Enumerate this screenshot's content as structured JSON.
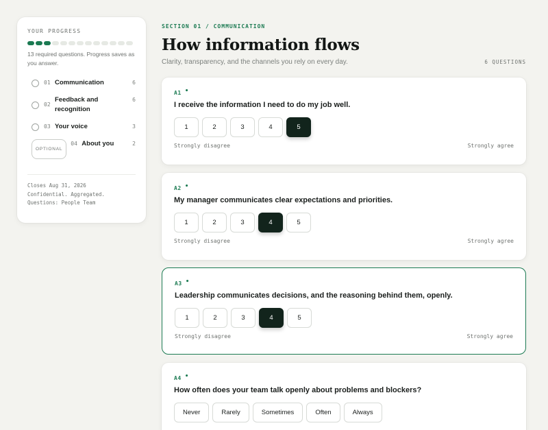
{
  "sidebar": {
    "progress_label": "YOUR PROGRESS",
    "progress": {
      "answered": 3,
      "total": 13
    },
    "note": "13 required questions. Progress saves as you answer.",
    "sections": [
      {
        "num": "01",
        "name": "Communication",
        "count": "6",
        "optional": false
      },
      {
        "num": "02",
        "name": "Feedback and recognition",
        "count": "6",
        "optional": false
      },
      {
        "num": "03",
        "name": "Your voice",
        "count": "3",
        "optional": false
      },
      {
        "num": "04",
        "name": "About you",
        "count": "2",
        "optional": true,
        "optional_label": "OPTIONAL"
      }
    ],
    "footer": [
      "Closes Aug 31, 2026",
      "Confidential. Aggregated.",
      "Questions: People Team"
    ]
  },
  "main": {
    "eyebrow": "SECTION 01 / COMMUNICATION",
    "title": "How information flows",
    "subtitle": "Clarity, transparency, and the channels you rely on every day.",
    "question_count": "6 QUESTIONS"
  },
  "questions": [
    {
      "id": "A1",
      "text": "I receive the information I need to do my job well.",
      "options": [
        "1",
        "2",
        "3",
        "4",
        "5"
      ],
      "selected": "5",
      "low": "Strongly disagree",
      "high": "Strongly agree",
      "active": false
    },
    {
      "id": "A2",
      "text": "My manager communicates clear expectations and priorities.",
      "options": [
        "1",
        "2",
        "3",
        "4",
        "5"
      ],
      "selected": "4",
      "low": "Strongly disagree",
      "high": "Strongly agree",
      "active": false
    },
    {
      "id": "A3",
      "text": "Leadership communicates decisions, and the reasoning behind them, openly.",
      "options": [
        "1",
        "2",
        "3",
        "4",
        "5"
      ],
      "selected": "4",
      "low": "Strongly disagree",
      "high": "Strongly agree",
      "active": true
    },
    {
      "id": "A4",
      "text": "How often does your team talk openly about problems and blockers?",
      "options": [
        "Never",
        "Rarely",
        "Sometimes",
        "Often",
        "Always"
      ],
      "selected": null,
      "low": "",
      "high": "",
      "active": false
    }
  ],
  "required_marker": "•",
  "colors": {
    "accent": "#1b7a52",
    "selected": "#12241c",
    "background": "#f3f3ef"
  }
}
